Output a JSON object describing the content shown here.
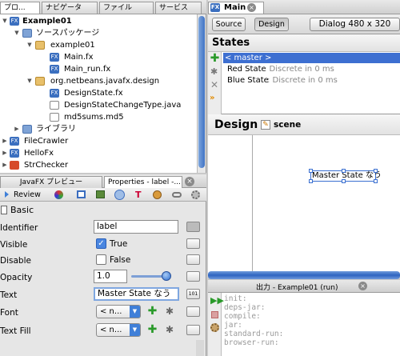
{
  "projects_panel": {
    "tabs": [
      "プロ...",
      "ナビゲータ",
      "ファイル",
      "サービス"
    ],
    "tree": [
      {
        "label": "Example01",
        "bold": true
      },
      {
        "label": "ソースパッケージ"
      },
      {
        "label": "example01"
      },
      {
        "label": "Main.fx"
      },
      {
        "label": "Main_run.fx"
      },
      {
        "label": "org.netbeans.javafx.design"
      },
      {
        "label": "DesignState.fx"
      },
      {
        "label": "DesignStateChangeType.java"
      },
      {
        "label": "md5sums.md5"
      },
      {
        "label": "ライブラリ"
      },
      {
        "label": "FileCrawler"
      },
      {
        "label": "HelloFx"
      },
      {
        "label": "StrChecker"
      }
    ]
  },
  "lower_tabs": {
    "preview": "JavaFX プレビュー",
    "properties": "Properties - label -..."
  },
  "review_label": "Review",
  "basic_label": "Basic",
  "properties": {
    "identifier_label": "Identifier",
    "identifier_value": "label",
    "visible_label": "Visible",
    "visible_value": "True",
    "disable_label": "Disable",
    "disable_value": "False",
    "opacity_label": "Opacity",
    "opacity_value": "1.0",
    "opacity_level": 1.0,
    "text_label": "Text",
    "text_value": "Master State なう",
    "font_label": "Font",
    "font_value": "< n...",
    "textfill_label": "Text Fill",
    "textfill_value": "< n..."
  },
  "editor": {
    "tab_title": "Main",
    "source_button": "Source",
    "design_button": "Design",
    "dialog_size": "Dialog 480 x 320",
    "states_title": "States",
    "states": [
      {
        "name": "< master >",
        "detail": "",
        "selected": true
      },
      {
        "name": "Red State",
        "detail": ": Discrete in 0 ms",
        "selected": false
      },
      {
        "name": "Blue State",
        "detail": ": Discrete in 0 ms",
        "selected": false
      }
    ],
    "design_title": "Design",
    "scene_label": "scene",
    "canvas_label": "Master State なう"
  },
  "output": {
    "title": "出力 - Example01 (run)",
    "lines": [
      "init:",
      "deps-jar:",
      "compile:",
      "jar:",
      "standard-run:",
      "browser-run:"
    ]
  },
  "colors": {
    "selection": "#3d6fd1",
    "accent_green": "#2a9a2a"
  }
}
